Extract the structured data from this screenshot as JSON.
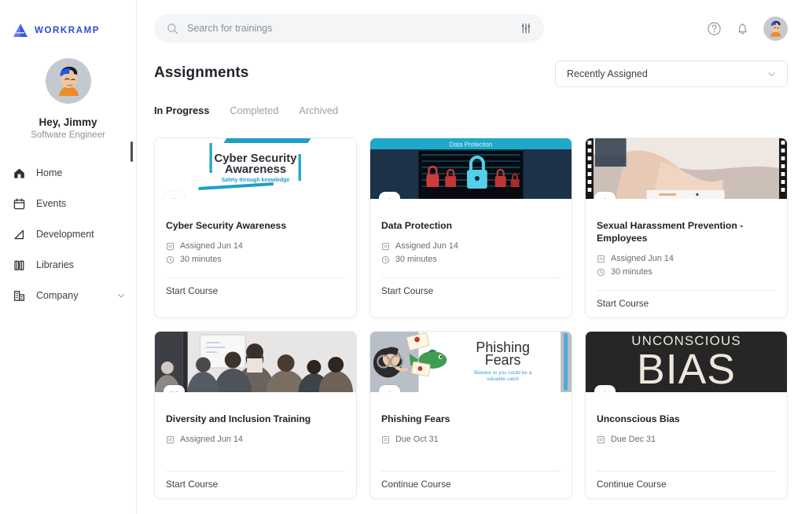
{
  "brand": {
    "name": "WORKRAMP",
    "color": "#2f4ad0"
  },
  "sidebar": {
    "profile": {
      "greeting": "Hey, Jimmy",
      "role": "Software Engineer",
      "avatar": "user-avatar"
    },
    "items": [
      {
        "label": "Home",
        "icon": "home-icon",
        "expandable": false
      },
      {
        "label": "Events",
        "icon": "calendar-icon",
        "expandable": false
      },
      {
        "label": "Development",
        "icon": "development-icon",
        "expandable": false
      },
      {
        "label": "Libraries",
        "icon": "books-icon",
        "expandable": false
      },
      {
        "label": "Company",
        "icon": "company-icon",
        "expandable": true
      }
    ]
  },
  "topbar": {
    "search_placeholder": "Search for trainings",
    "search_value": "",
    "search_icon": "search-icon",
    "filter_icon": "filter-sliders-icon",
    "help_icon": "help-circle-icon",
    "bell_icon": "notification-bell-icon",
    "avatar": "user-avatar"
  },
  "page": {
    "title": "Assignments",
    "sort": {
      "selected": "Recently Assigned",
      "chevron": "chevron-down-icon"
    },
    "tabs": [
      {
        "label": "In Progress",
        "active": true
      },
      {
        "label": "Completed",
        "active": false
      },
      {
        "label": "Archived",
        "active": false
      }
    ]
  },
  "cards": [
    {
      "title": "Cyber Security Awareness",
      "badge_icon": "graduation-cap-icon",
      "badge_color": "#d9423f",
      "thumb": "cyber-security-awareness-thumb",
      "meta": [
        {
          "icon": "assignment-icon",
          "text": "Assigned Jun 14"
        },
        {
          "icon": "clock-icon",
          "text": "30 minutes"
        }
      ],
      "cta": "Start Course"
    },
    {
      "title": "Data Protection",
      "badge_icon": "graduation-cap-icon",
      "badge_color": "#d9423f",
      "thumb": "data-protection-thumb",
      "thumb_banner": "Data Protection",
      "meta": [
        {
          "icon": "assignment-icon",
          "text": "Assigned Jun 14"
        },
        {
          "icon": "clock-icon",
          "text": "30 minutes"
        }
      ],
      "cta": "Start Course"
    },
    {
      "title": "Sexual Harassment Prevention - Employees",
      "badge_icon": "graduation-cap-icon",
      "badge_color": "#d9423f",
      "thumb": "hands-keyboard-filmstrip-thumb",
      "meta": [
        {
          "icon": "assignment-icon",
          "text": "Assigned Jun 14"
        },
        {
          "icon": "clock-icon",
          "text": "30 minutes"
        }
      ],
      "cta": "Start Course"
    },
    {
      "title": "Diversity and Inclusion Training",
      "badge_icon": "open-book-icon",
      "badge_color": "#2f6fe4",
      "thumb": "classroom-meeting-thumb",
      "meta": [
        {
          "icon": "assignment-icon",
          "text": "Assigned Jun 14"
        }
      ],
      "cta": "Start Course"
    },
    {
      "title": "Phishing Fears",
      "badge_icon": "graduation-cap-icon",
      "badge_color": "#d9423f",
      "thumb": "phishing-fears-thumb",
      "thumb_title": "Phishing Fears",
      "thumb_subtitle": "Beware or you could be a valuable catch",
      "meta": [
        {
          "icon": "assignment-icon",
          "text": "Due Oct 31"
        }
      ],
      "cta": "Continue Course"
    },
    {
      "title": "Unconscious Bias",
      "badge_icon": "graduation-cap-icon",
      "badge_color": "#d9423f",
      "thumb": "unconscious-bias-thumb",
      "thumb_line1": "UNCONSCIOUS",
      "thumb_line2": "BIAS",
      "meta": [
        {
          "icon": "assignment-icon",
          "text": "Due Dec 31"
        }
      ],
      "cta": "Continue Course"
    }
  ]
}
